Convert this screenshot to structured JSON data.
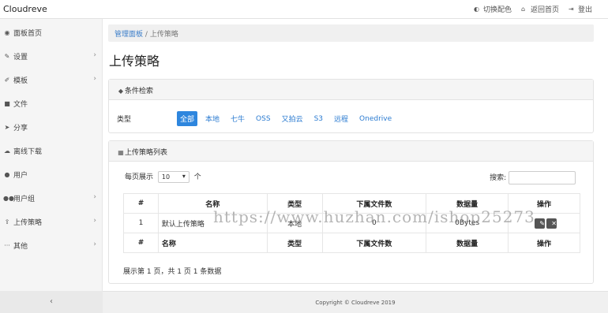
{
  "app": {
    "title": "Cloudreve"
  },
  "top_actions": [
    {
      "icon": "toggle-icon",
      "label": "切换配色"
    },
    {
      "icon": "home-icon",
      "label": "返回首页"
    },
    {
      "icon": "logout-icon",
      "label": "登出"
    }
  ],
  "sidebar": {
    "items": [
      {
        "icon": "dashboard-icon",
        "label": "面板首页",
        "has_chevron": false
      },
      {
        "icon": "wrench-icon",
        "label": "设置",
        "has_chevron": true
      },
      {
        "icon": "brush-icon",
        "label": "模板",
        "has_chevron": true
      },
      {
        "icon": "folder-icon",
        "label": "文件",
        "has_chevron": false
      },
      {
        "icon": "share-icon",
        "label": "分享",
        "has_chevron": false
      },
      {
        "icon": "cloud-download-icon",
        "label": "离线下载",
        "has_chevron": false
      },
      {
        "icon": "user-icon",
        "label": "用户",
        "has_chevron": false
      },
      {
        "icon": "users-icon",
        "label": "用户组",
        "has_chevron": true
      },
      {
        "icon": "upload-icon",
        "label": "上传策略",
        "has_chevron": true
      },
      {
        "icon": "ellipsis-icon",
        "label": "其他",
        "has_chevron": true
      }
    ],
    "collapse_glyph": "‹"
  },
  "breadcrumb": {
    "root": "管理面板",
    "separator": "/",
    "current": "上传策略"
  },
  "page_title": "上传策略",
  "filter_panel": {
    "heading": "条件检索",
    "type_label": "类型",
    "chips": [
      "全部",
      "本地",
      "七牛",
      "OSS",
      "又拍云",
      "S3",
      "远程",
      "Onedrive"
    ],
    "active_chip": "全部"
  },
  "list_panel": {
    "heading": "上传策略列表",
    "page_size_prefix": "每页展示",
    "page_size_value": "10",
    "page_size_suffix": "个",
    "search_label": "搜索:",
    "columns": [
      "#",
      "名称",
      "类型",
      "下属文件数",
      "数据量",
      "操作"
    ],
    "rows": [
      {
        "id": "1",
        "name": "默认上传策略",
        "type": "本地",
        "files": "0",
        "size": "0Bytes"
      }
    ],
    "summary": "展示第 1 页，共 1 页 1 条数据"
  },
  "footer": {
    "text": "Copyright © Cloudreve 2019"
  },
  "watermark": "https://www.huzhan.com/ishop25273",
  "colors": {
    "accent": "#2e86de",
    "link": "#3a7dc9"
  }
}
